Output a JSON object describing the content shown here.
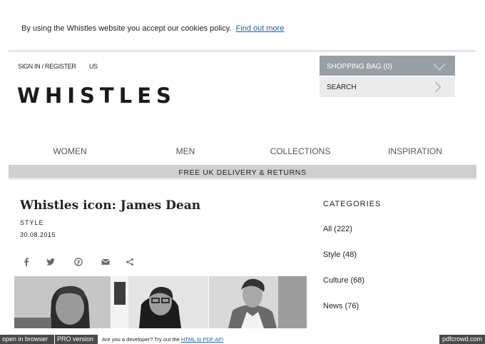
{
  "cookie_bar": {
    "text": "By using the Whistles website you accept our cookies policy.",
    "link": "Find out more"
  },
  "header": {
    "sign_in": "SIGN IN / REGISTER",
    "region": "US",
    "logo": "WHISTLES",
    "bag_label": "SHOPPING BAG (0)",
    "search_label": "SEARCH"
  },
  "nav": {
    "items": [
      "WOMEN",
      "MEN",
      "COLLECTIONS",
      "INSPIRATION"
    ]
  },
  "promo": {
    "text": "FREE UK DELIVERY & RETURNS"
  },
  "article": {
    "title": "Whistles icon: James Dean",
    "category": "STYLE",
    "date": "30.08.2015",
    "share_icons": [
      "facebook-icon",
      "twitter-icon",
      "pinterest-icon",
      "email-icon",
      "share-icon"
    ]
  },
  "sidebar": {
    "heading": "CATEGORIES",
    "items": [
      "All (222)",
      "Style (48)",
      "Culture (68)",
      "News (76)"
    ]
  },
  "pdf_bar": {
    "open_browser": "open in browser",
    "pro": "PRO version",
    "dev_text": "Are you a developer? Try out the",
    "dev_link": "HTML to PDF API",
    "brand": "pdfcrowd.com"
  },
  "colors": {
    "bag_button": "#98a0a6",
    "search_button": "#ebebeb",
    "delivery_bar": "#cfcfcf",
    "link": "#1a5fb4",
    "pdf_bar": "#4a4a4a"
  }
}
